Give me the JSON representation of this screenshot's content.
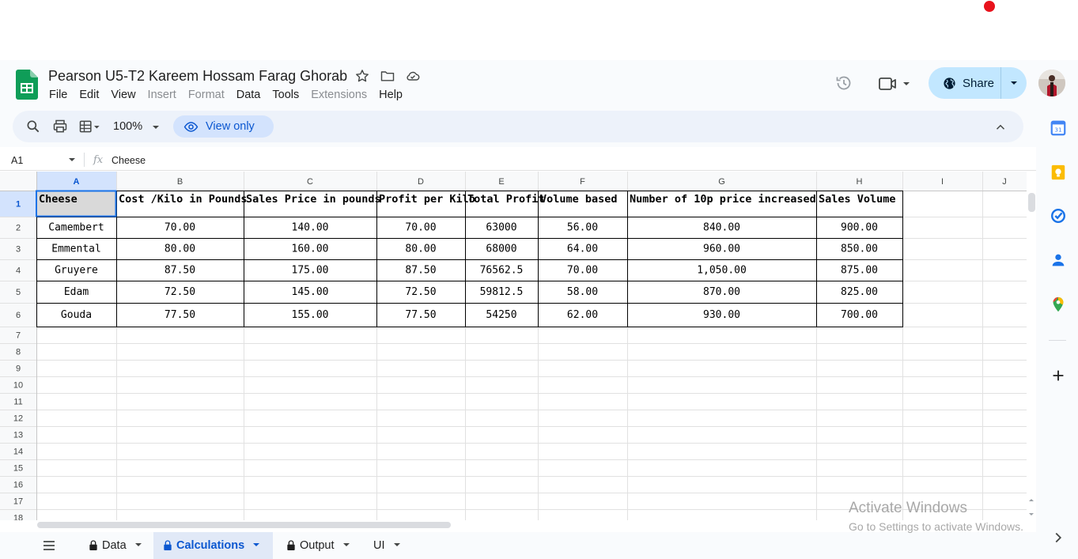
{
  "doc": {
    "title": "Pearson U5-T2 Kareem Hossam Farag Ghorab"
  },
  "menu": [
    {
      "label": "File",
      "enabled": true
    },
    {
      "label": "Edit",
      "enabled": true
    },
    {
      "label": "View",
      "enabled": true
    },
    {
      "label": "Insert",
      "enabled": false
    },
    {
      "label": "Format",
      "enabled": false
    },
    {
      "label": "Data",
      "enabled": true
    },
    {
      "label": "Tools",
      "enabled": true
    },
    {
      "label": "Extensions",
      "enabled": false
    },
    {
      "label": "Help",
      "enabled": true
    }
  ],
  "share": {
    "label": "Share"
  },
  "toolbar": {
    "zoom": "100%",
    "view_only": "View only"
  },
  "formula_bar": {
    "cell_ref": "A1",
    "fx": "fx",
    "value": "Cheese"
  },
  "sheet": {
    "columns": [
      "A",
      "B",
      "C",
      "D",
      "E",
      "F",
      "G",
      "H",
      "I",
      "J"
    ],
    "row_numbers": [
      "1",
      "2",
      "3",
      "4",
      "5",
      "6",
      "7",
      "8",
      "9",
      "10",
      "11",
      "12",
      "13",
      "14",
      "15",
      "16",
      "17",
      "18"
    ],
    "header": [
      "Cheese",
      "Cost /Kilo in Pounds",
      "Sales Price in pounds",
      "Profit per Kilo",
      "Total Profit",
      "Volume based",
      "Number of 10p price increased",
      "Sales Volume"
    ],
    "rows": [
      [
        "Camembert",
        "70.00",
        "140.00",
        "70.00",
        "63000",
        "56.00",
        "840.00",
        "900.00"
      ],
      [
        "Emmental",
        "80.00",
        "160.00",
        "80.00",
        "68000",
        "64.00",
        "960.00",
        "850.00"
      ],
      [
        "Gruyere",
        "87.50",
        "175.00",
        "87.50",
        "76562.5",
        "70.00",
        "1,050.00",
        "875.00"
      ],
      [
        "Edam",
        "72.50",
        "145.00",
        "72.50",
        "59812.5",
        "58.00",
        "870.00",
        "825.00"
      ],
      [
        "Gouda",
        "77.50",
        "155.00",
        "77.50",
        "54250",
        "62.00",
        "930.00",
        "700.00"
      ]
    ]
  },
  "tabs": [
    {
      "label": "Data",
      "locked": true,
      "active": false
    },
    {
      "label": "Calculations",
      "locked": true,
      "active": true
    },
    {
      "label": "Output",
      "locked": true,
      "active": false
    },
    {
      "label": "UI",
      "locked": false,
      "active": false
    }
  ],
  "watermark": {
    "line1": "Activate Windows",
    "line2": "Go to Settings to activate Windows."
  },
  "colors": {
    "accent": "#0b57d0",
    "share_bg": "#c2e7ff",
    "sheets_green": "#0f9d58",
    "selection": "#1a73e8"
  }
}
